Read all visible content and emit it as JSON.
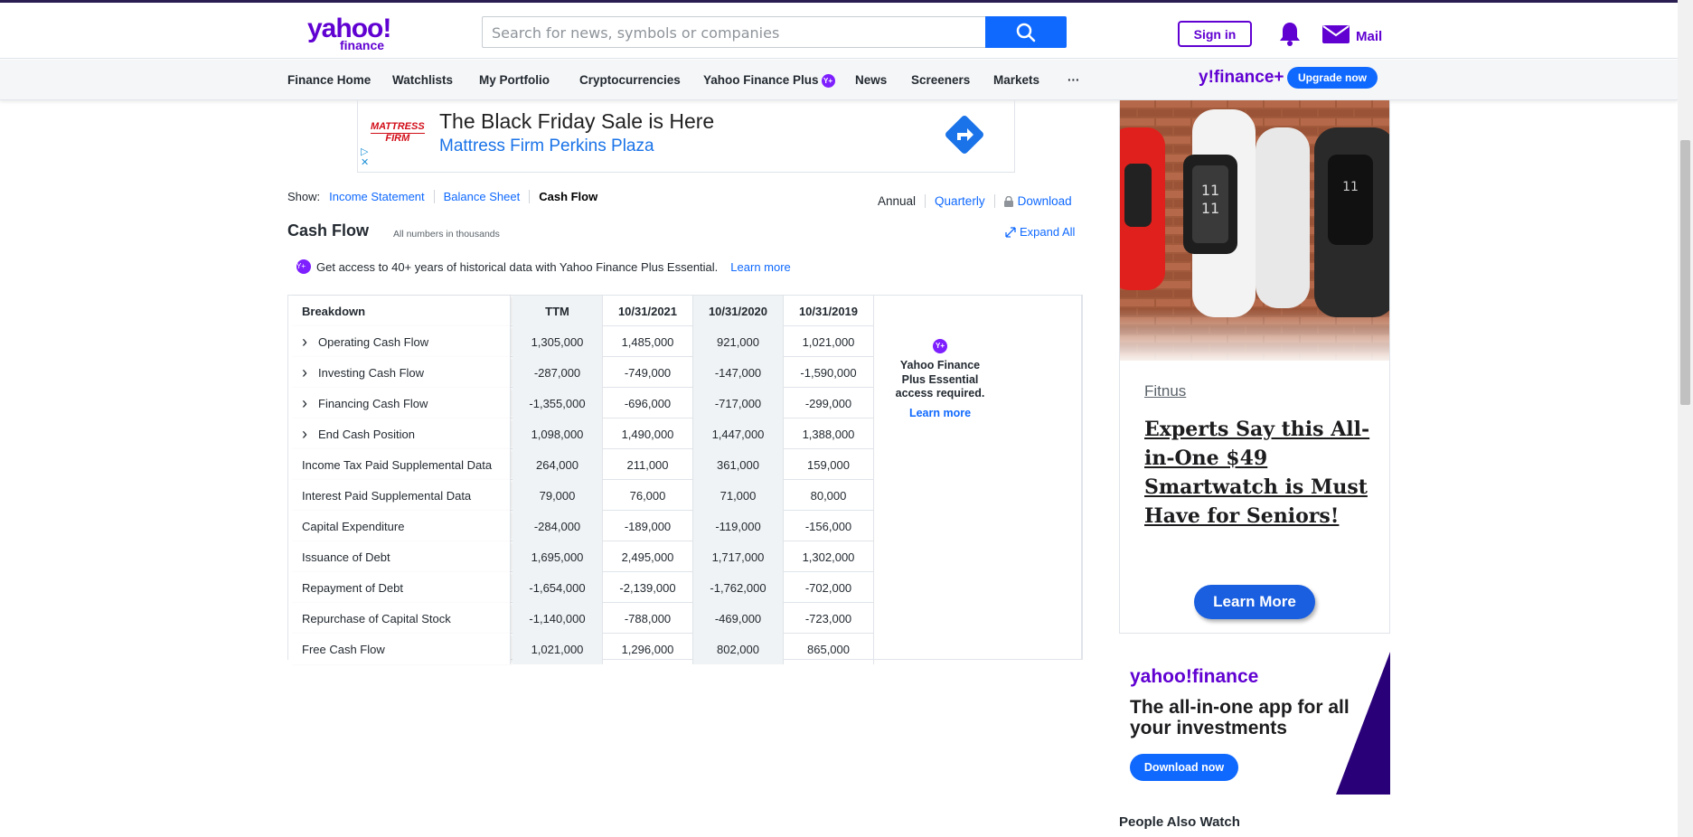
{
  "header": {
    "logo_main": "yahoo!",
    "logo_sub": "finance",
    "search_placeholder": "Search for news, symbols or companies",
    "signin_label": "Sign in",
    "mail_label": "Mail"
  },
  "nav": {
    "items": [
      "Finance Home",
      "Watchlists",
      "My Portfolio",
      "Cryptocurrencies",
      "Yahoo Finance Plus",
      "News",
      "Screeners",
      "Markets",
      "···"
    ],
    "plus_badge": "Y+",
    "yfp_logo": "y!finance+",
    "upgrade_label": "Upgrade now"
  },
  "ad_banner": {
    "brand_line1": "MATTRESS",
    "brand_line2": "FIRM",
    "headline": "The Black Friday Sale is Here",
    "subline": "Mattress Firm Perkins Plaza"
  },
  "show": {
    "label": "Show:",
    "income": "Income Statement",
    "balance": "Balance Sheet",
    "cashflow": "Cash Flow"
  },
  "period": {
    "annual": "Annual",
    "quarterly": "Quarterly",
    "download": "Download"
  },
  "section": {
    "title": "Cash Flow",
    "note": "All numbers in thousands",
    "expand": "Expand All",
    "access_text": "Get access to 40+ years of historical data with Yahoo Finance Plus Essential.",
    "access_learn": "Learn more",
    "access_badge": "Y+"
  },
  "table": {
    "headers": [
      "Breakdown",
      "TTM",
      "10/31/2021",
      "10/31/2020",
      "10/31/2019"
    ],
    "rows": [
      {
        "label": "Operating Cash Flow",
        "expandable": true,
        "values": [
          "1,305,000",
          "1,485,000",
          "921,000",
          "1,021,000"
        ]
      },
      {
        "label": "Investing Cash Flow",
        "expandable": true,
        "values": [
          "-287,000",
          "-749,000",
          "-147,000",
          "-1,590,000"
        ]
      },
      {
        "label": "Financing Cash Flow",
        "expandable": true,
        "values": [
          "-1,355,000",
          "-696,000",
          "-717,000",
          "-299,000"
        ]
      },
      {
        "label": "End Cash Position",
        "expandable": true,
        "values": [
          "1,098,000",
          "1,490,000",
          "1,447,000",
          "1,388,000"
        ]
      },
      {
        "label": "Income Tax Paid Supplemental Data",
        "expandable": false,
        "values": [
          "264,000",
          "211,000",
          "361,000",
          "159,000"
        ]
      },
      {
        "label": "Interest Paid Supplemental Data",
        "expandable": false,
        "values": [
          "79,000",
          "76,000",
          "71,000",
          "80,000"
        ]
      },
      {
        "label": "Capital Expenditure",
        "expandable": false,
        "values": [
          "-284,000",
          "-189,000",
          "-119,000",
          "-156,000"
        ]
      },
      {
        "label": "Issuance of Debt",
        "expandable": false,
        "values": [
          "1,695,000",
          "2,495,000",
          "1,717,000",
          "1,302,000"
        ]
      },
      {
        "label": "Repayment of Debt",
        "expandable": false,
        "values": [
          "-1,654,000",
          "-2,139,000",
          "-1,762,000",
          "-702,000"
        ]
      },
      {
        "label": "Repurchase of Capital Stock",
        "expandable": false,
        "values": [
          "-1,140,000",
          "-788,000",
          "-469,000",
          "-723,000"
        ]
      },
      {
        "label": "Free Cash Flow",
        "expandable": false,
        "values": [
          "1,021,000",
          "1,296,000",
          "802,000",
          "865,000"
        ]
      }
    ],
    "plus_line1": "Yahoo Finance",
    "plus_line2": "Plus Essential",
    "plus_line3": "access required.",
    "plus_learn": "Learn more"
  },
  "side_ad": {
    "brand": "Fitnus",
    "headline": "Experts Say this All-in-One $49 Smartwatch is Must Have for Seniors!",
    "cta": "Learn More"
  },
  "app_ad": {
    "logo": "yahoo!finance",
    "text": "The all-in-one app for all your investments",
    "cta": "Download now"
  },
  "people_watch": "People Also Watch",
  "colors": {
    "brand_purple": "#6001d2",
    "link_blue": "#0f69ff",
    "plus_purple": "#7e1fff"
  }
}
